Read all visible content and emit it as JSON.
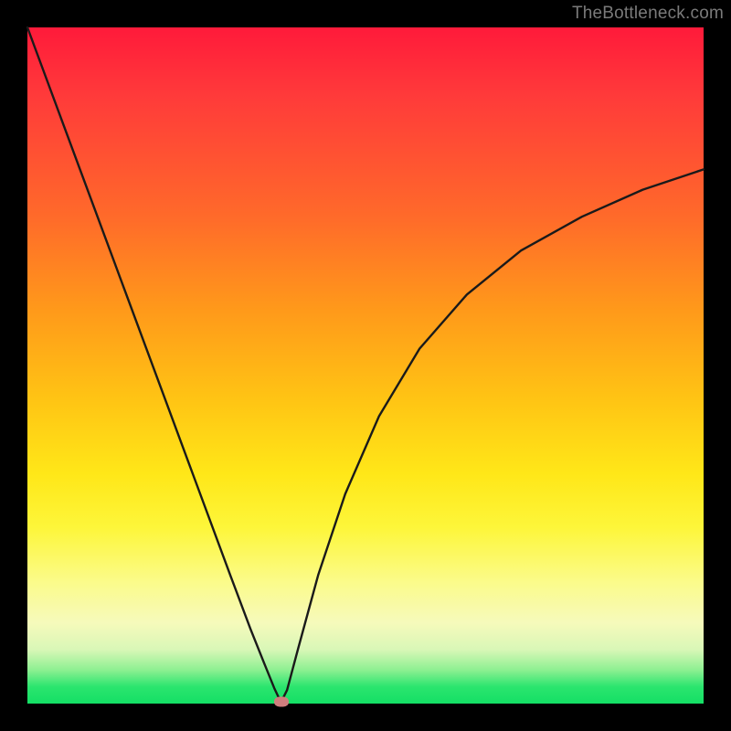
{
  "watermark": "TheBottleneck.com",
  "chart_data": {
    "type": "line",
    "title": "",
    "xlabel": "",
    "ylabel": "",
    "xlim": [
      0,
      100
    ],
    "ylim": [
      0,
      100
    ],
    "grid": false,
    "legend": false,
    "series": [
      {
        "name": "bottleneck-curve",
        "x": [
          0,
          5,
          10,
          15,
          20,
          25,
          30,
          33,
          35,
          36.5,
          37.3,
          37.7,
          38.4,
          40,
          43,
          47,
          52,
          58,
          65,
          73,
          82,
          91,
          100
        ],
        "y": [
          100,
          86.5,
          73,
          59.5,
          46,
          32.5,
          19,
          11,
          6,
          2.3,
          0.6,
          0.6,
          2.0,
          8,
          19,
          31,
          42.5,
          52.5,
          60.5,
          67,
          72,
          76,
          79
        ]
      }
    ],
    "marker": {
      "x": 37.5,
      "y": 0.3,
      "color": "#cf7d7d"
    },
    "gradient_colors": {
      "top": "#ff1a3a",
      "mid_upper": "#ff9a1a",
      "mid": "#ffe718",
      "mid_lower": "#f6fabb",
      "bottom": "#14df65"
    }
  }
}
